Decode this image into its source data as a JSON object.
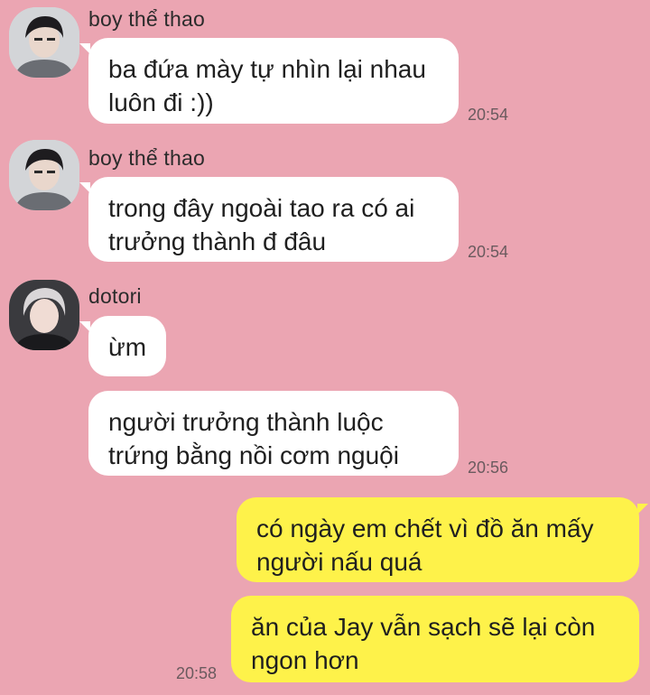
{
  "messages": [
    {
      "sender": "boy thể thao",
      "lines": [
        "ba đứa mày tự nhìn lại nhau",
        "luôn đi :))"
      ],
      "time": "20:54"
    },
    {
      "sender": "boy thể thao",
      "lines": [
        "trong đây ngoài tao ra có ai",
        "trưởng thành đ đâu"
      ],
      "time": "20:54"
    },
    {
      "sender": "dotori",
      "lines": [
        "ừm"
      ]
    },
    {
      "lines": [
        "người trưởng thành luộc",
        "trứng bằng nồi cơm nguội"
      ],
      "time": "20:56"
    },
    {
      "lines": [
        "có ngày em chết vì đồ ăn mấy",
        "người nấu quá"
      ]
    },
    {
      "lines": [
        "ăn của Jay vẫn sạch sẽ lại còn",
        "ngon hơn"
      ],
      "time": "20:58"
    }
  ],
  "colors": {
    "background": "#eba5b2",
    "incoming_bubble": "#ffffff",
    "outgoing_bubble": "#fef24a"
  },
  "icons": {
    "avatar_boy": "profile-photo-avatar",
    "avatar_dotori": "profile-photo-avatar"
  }
}
